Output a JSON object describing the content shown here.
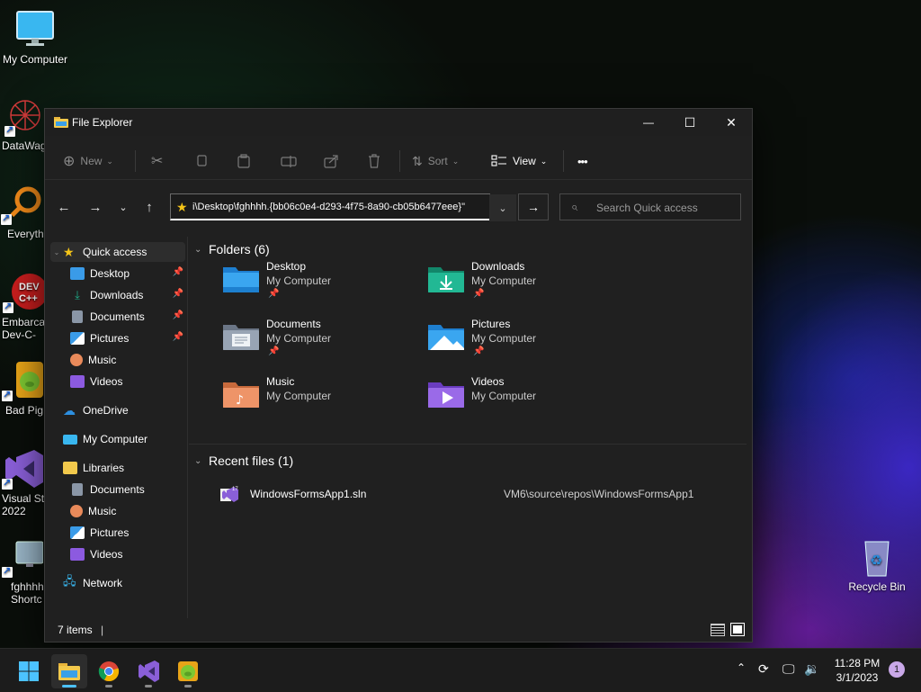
{
  "desktop": {
    "icons": [
      {
        "label": "My Computer"
      },
      {
        "label": "DataWag"
      },
      {
        "label": "Everyth"
      },
      {
        "label": "Embarca\nDev-C-"
      },
      {
        "label": "Bad Pig"
      },
      {
        "label": "Visual St\n2022"
      },
      {
        "label": "fghhhh\nShortc"
      },
      {
        "label": "Recycle Bin"
      }
    ]
  },
  "window": {
    "title": "File Explorer",
    "controls": {
      "minimize": "—",
      "maximize": "☐",
      "close": "✕"
    }
  },
  "toolbar": {
    "new_label": "New",
    "sort_label": "Sort",
    "view_label": "View",
    "more_label": "•••"
  },
  "address": {
    "text": "i\\Desktop\\fghhhh.{bb06c0e4-d293-4f75-8a90-cb05b6477eee}\""
  },
  "search": {
    "placeholder": "Search Quick access"
  },
  "sidebar": {
    "items": [
      {
        "label": "Quick access"
      },
      {
        "label": "Desktop"
      },
      {
        "label": "Downloads"
      },
      {
        "label": "Documents"
      },
      {
        "label": "Pictures"
      },
      {
        "label": "Music"
      },
      {
        "label": "Videos"
      },
      {
        "label": "OneDrive"
      },
      {
        "label": "My Computer"
      },
      {
        "label": "Libraries"
      },
      {
        "label": "Documents"
      },
      {
        "label": "Music"
      },
      {
        "label": "Pictures"
      },
      {
        "label": "Videos"
      },
      {
        "label": "Network"
      }
    ]
  },
  "main": {
    "folders_header": "Folders (6)",
    "folders": [
      {
        "name": "Desktop",
        "location": "My Computer",
        "pinned": true,
        "color": "#3a9be8"
      },
      {
        "name": "Downloads",
        "location": "My Computer",
        "pinned": true,
        "color": "#1fae8a"
      },
      {
        "name": "Documents",
        "location": "My Computer",
        "pinned": true,
        "color": "#8a96a6"
      },
      {
        "name": "Pictures",
        "location": "My Computer",
        "pinned": true,
        "color": "#3a9be8"
      },
      {
        "name": "Music",
        "location": "My Computer",
        "pinned": false,
        "color": "#e98a5a"
      },
      {
        "name": "Videos",
        "location": "My Computer",
        "pinned": false,
        "color": "#8c5ae0"
      }
    ],
    "recent_header": "Recent files (1)",
    "recent_files": [
      {
        "name": "WindowsFormsApp1.sln",
        "path": "VM6\\source\\repos\\WindowsFormsApp1"
      }
    ]
  },
  "status": {
    "items": "7 items",
    "divider": "|"
  },
  "taskbar": {
    "clock_time": "11:28 PM",
    "clock_date": "3/1/2023",
    "notification_count": "1"
  },
  "colors": {
    "accent": "#4cc2ff",
    "window_bg": "#202020",
    "folder_blue": "#3a9be8"
  }
}
